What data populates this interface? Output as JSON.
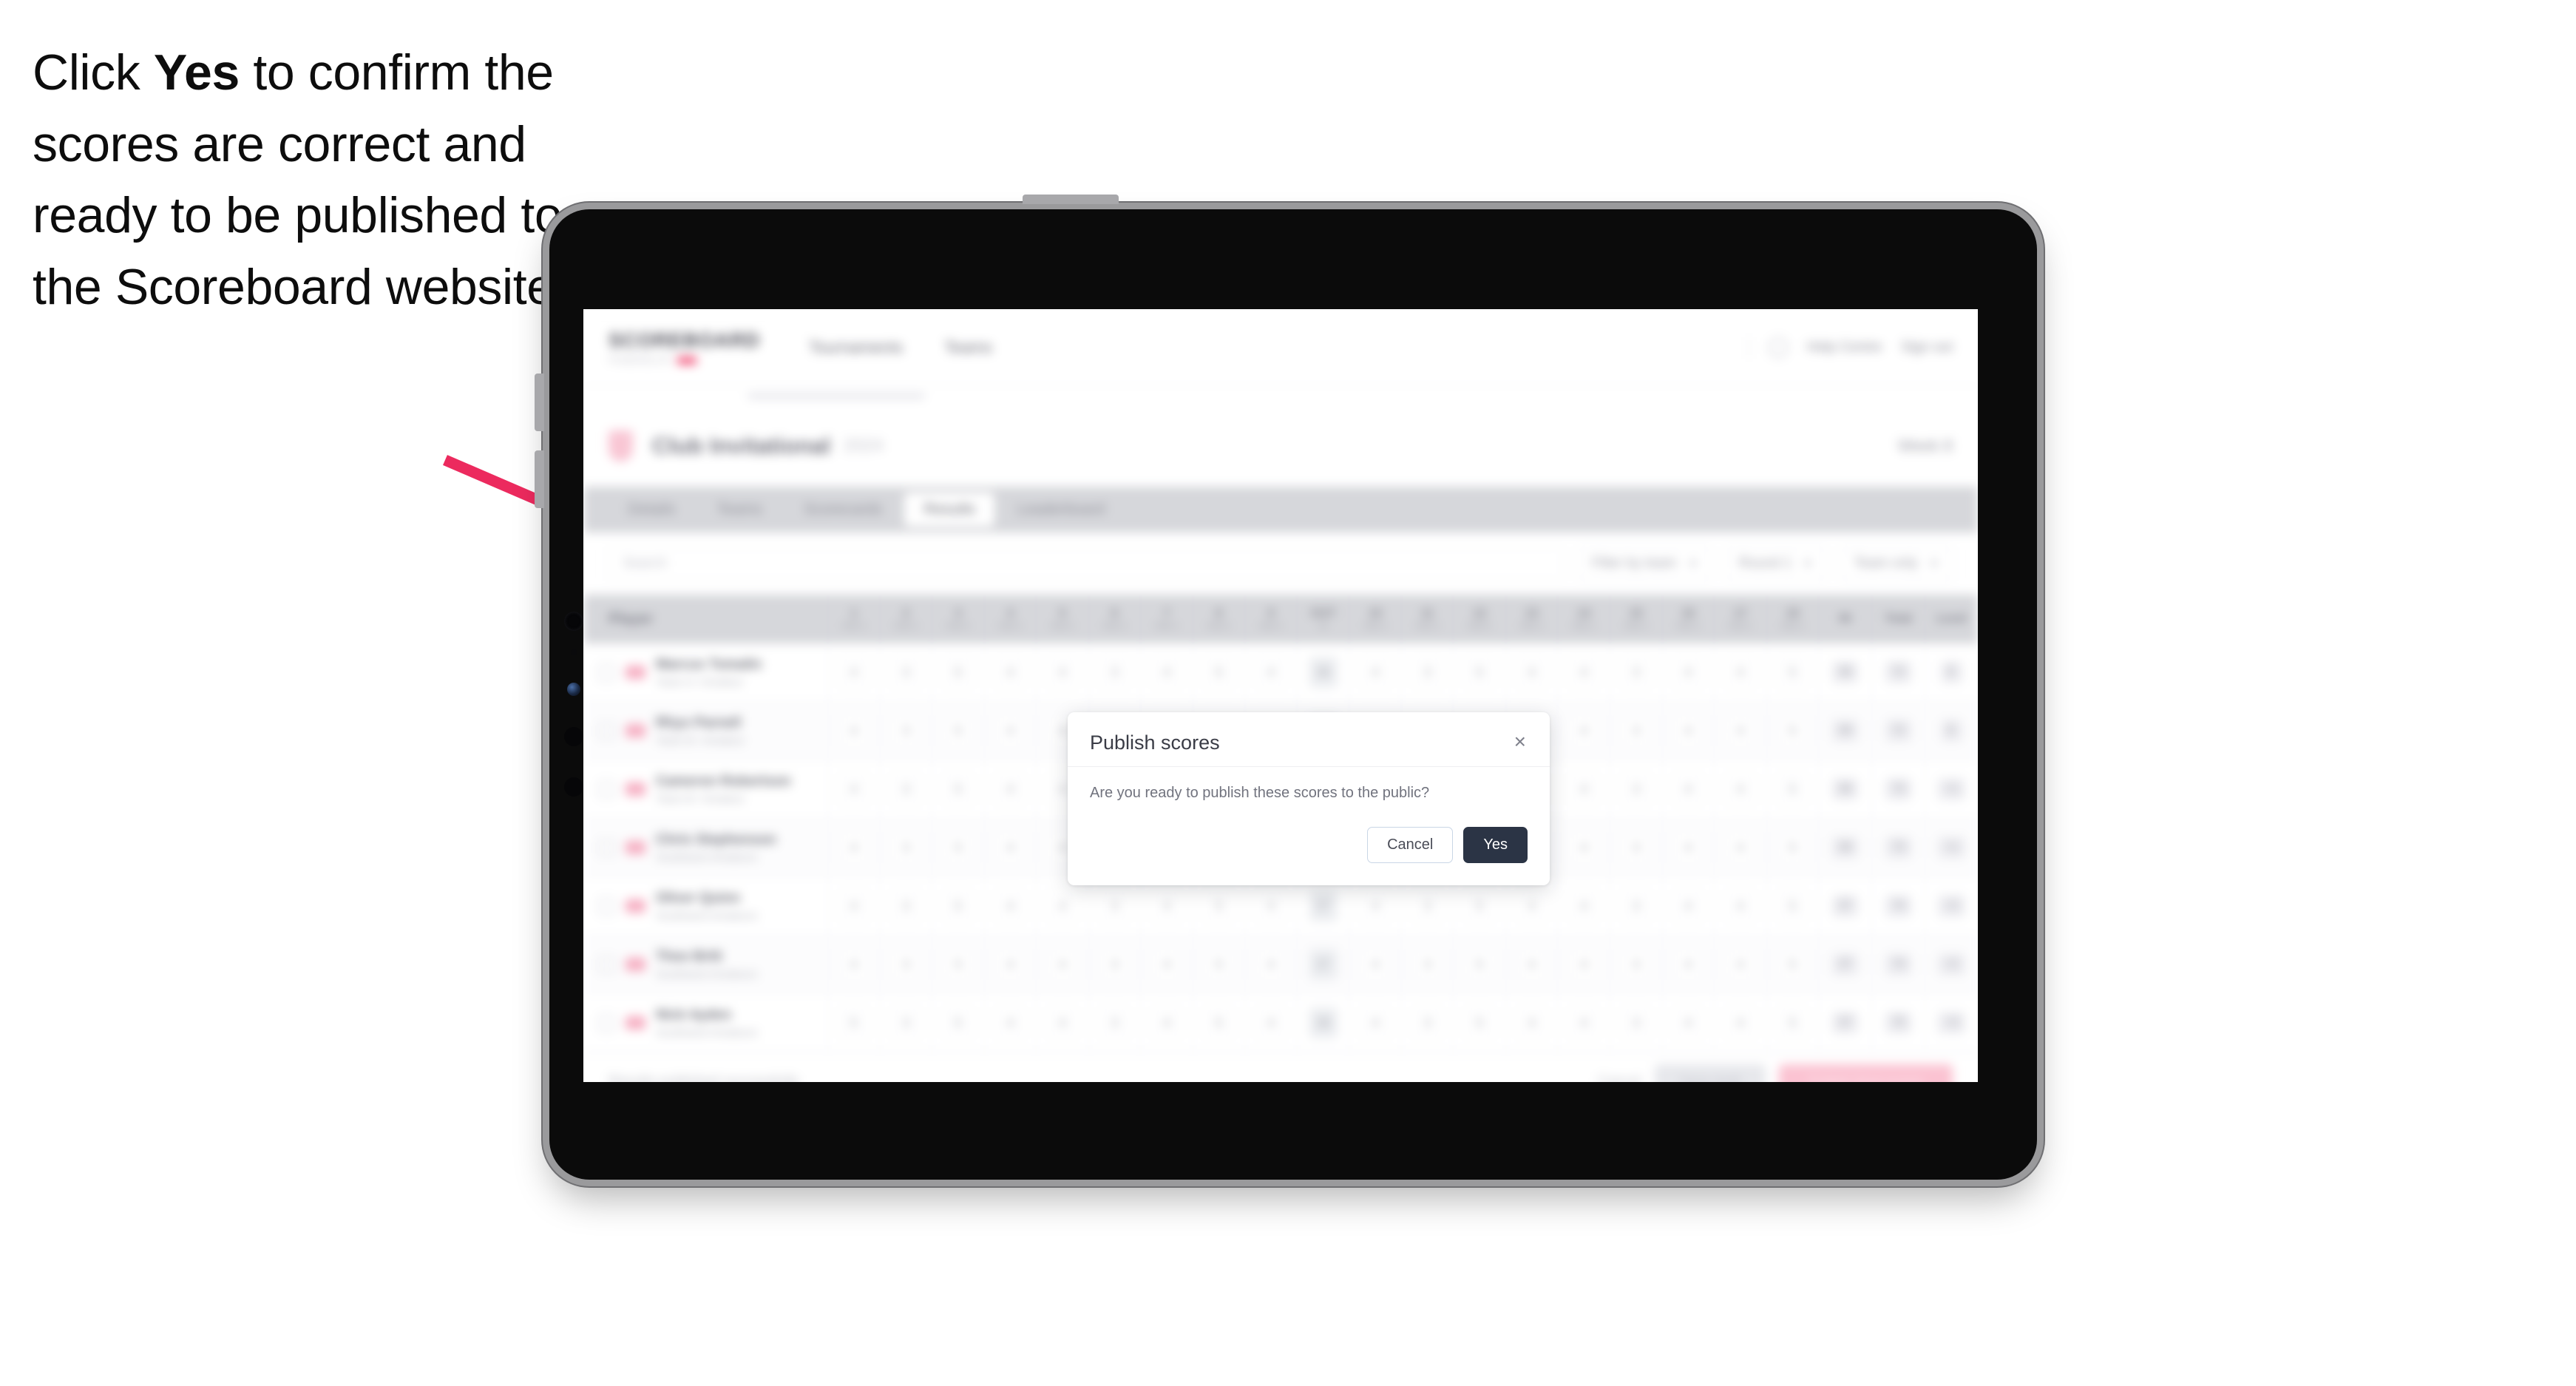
{
  "callout": {
    "before": "Click ",
    "bold": "Yes",
    "after": " to confirm the scores are correct and ready to be published to the Scoreboard website."
  },
  "colors": {
    "accent_pink": "#ef3a66",
    "arrow_pink": "#ec2a5e",
    "yes_button": "#2b3445",
    "cancel_border": "#c9d6e6",
    "tabbar_bg": "#d6d7db"
  },
  "device": {
    "kind": "tablet",
    "orientation": "landscape",
    "buttons": [
      "power",
      "volume-up",
      "volume-down"
    ]
  },
  "app": {
    "brand": {
      "word": "SCOREBOARD",
      "sub": "POWERED BY"
    },
    "nav": [
      "Tournaments",
      "Teams"
    ],
    "header_right": [
      "Help Centre",
      "Sign out"
    ],
    "title": {
      "main": "Club Invitational",
      "meta": "2024",
      "right": "Week 8"
    },
    "tabs": [
      {
        "label": "Details",
        "active": false
      },
      {
        "label": "Teams",
        "active": false
      },
      {
        "label": "Scorecards",
        "active": false
      },
      {
        "label": "Results",
        "active": true
      },
      {
        "label": "Leaderboard",
        "active": false
      }
    ],
    "toolbar": {
      "search_placeholder": "Search",
      "filters": [
        "Filter by team",
        "Round 1",
        "Team only"
      ]
    },
    "table": {
      "player_header": "Player",
      "holes": [
        {
          "n": "1",
          "p": "PAR 4"
        },
        {
          "n": "2",
          "p": "PAR 3"
        },
        {
          "n": "3",
          "p": "PAR 5"
        },
        {
          "n": "4",
          "p": "PAR 4"
        },
        {
          "n": "5",
          "p": "PAR 4"
        },
        {
          "n": "6",
          "p": "PAR 3"
        },
        {
          "n": "7",
          "p": "PAR 4"
        },
        {
          "n": "8",
          "p": "PAR 5"
        },
        {
          "n": "9",
          "p": "PAR 4"
        },
        {
          "n": "OUT",
          "p": "36"
        },
        {
          "n": "10",
          "p": "PAR 4"
        },
        {
          "n": "11",
          "p": "PAR 3"
        },
        {
          "n": "12",
          "p": "PAR 5"
        },
        {
          "n": "13",
          "p": "PAR 4"
        },
        {
          "n": "14",
          "p": "PAR 4"
        },
        {
          "n": "15",
          "p": "PAR 3"
        },
        {
          "n": "16",
          "p": "PAR 4"
        },
        {
          "n": "17",
          "p": "PAR 4"
        },
        {
          "n": "18",
          "p": "PAR 5"
        }
      ],
      "summary_headers": [
        "IN",
        "Total",
        "Level"
      ],
      "rows": [
        {
          "name": "Marcus Tomalin",
          "sub": "Team A  •  Amateur",
          "scores": [
            "4",
            "3",
            "5",
            "4",
            "4",
            "3",
            "4",
            "5",
            "4",
            "36",
            "4",
            "3",
            "5",
            "4",
            "4",
            "3",
            "4",
            "4",
            "5"
          ],
          "summary": [
            "36",
            "72",
            "E"
          ]
        },
        {
          "name": "Rhys Parnell",
          "sub": "Team B  •  Amateur",
          "scores": [
            "4",
            "3",
            "5",
            "4",
            "4",
            "3",
            "4",
            "5",
            "4",
            "36",
            "4",
            "3",
            "5",
            "4",
            "4",
            "3",
            "4",
            "4",
            "5"
          ],
          "summary": [
            "36",
            "72",
            "E"
          ]
        },
        {
          "name": "Cameron Robertson",
          "sub": "Team B  •  Amateur",
          "scores": [
            "4",
            "3",
            "5",
            "4",
            "4",
            "3",
            "4",
            "5",
            "4",
            "36",
            "4",
            "3",
            "5",
            "4",
            "4",
            "3",
            "4",
            "4",
            "5"
          ],
          "summary": [
            "36",
            "73",
            "+1"
          ]
        },
        {
          "name": "Chris Stephenson",
          "sub": "Southwest Amateurs",
          "scores": [
            "4",
            "3",
            "5",
            "4",
            "4",
            "3",
            "4",
            "5",
            "4",
            "37",
            "4",
            "3",
            "5",
            "4",
            "4",
            "3",
            "4",
            "4",
            "5"
          ],
          "summary": [
            "36",
            "73",
            "+1"
          ]
        },
        {
          "name": "Oliver Quinn",
          "sub": "Southwest Amateurs",
          "scores": [
            "4",
            "3",
            "5",
            "4",
            "4",
            "3",
            "4",
            "5",
            "4",
            "37",
            "4",
            "3",
            "5",
            "4",
            "4",
            "3",
            "4",
            "4",
            "5"
          ],
          "summary": [
            "37",
            "74",
            "+2"
          ]
        },
        {
          "name": "Theo Britt",
          "sub": "Southwest Amateurs",
          "scores": [
            "4",
            "3",
            "5",
            "4",
            "4",
            "3",
            "4",
            "5",
            "4",
            "37",
            "4",
            "3",
            "5",
            "4",
            "4",
            "3",
            "4",
            "4",
            "5"
          ],
          "summary": [
            "37",
            "74",
            "+2"
          ]
        },
        {
          "name": "Nick Ayden",
          "sub": "Southwest Amateurs",
          "scores": [
            "5",
            "3",
            "5",
            "4",
            "4",
            "3",
            "4",
            "5",
            "4",
            "38",
            "4",
            "3",
            "5",
            "4",
            "4",
            "3",
            "4",
            "4",
            "5"
          ],
          "summary": [
            "37",
            "75",
            "+3"
          ]
        }
      ]
    },
    "footer": {
      "note": "Results published successfully",
      "link": "Cancel",
      "secondary_button": "Save draft",
      "primary_button": "Publish final scores"
    }
  },
  "modal": {
    "title": "Publish scores",
    "close_icon": "×",
    "body": "Are you ready to publish these scores to the public?",
    "cancel_label": "Cancel",
    "yes_label": "Yes"
  }
}
